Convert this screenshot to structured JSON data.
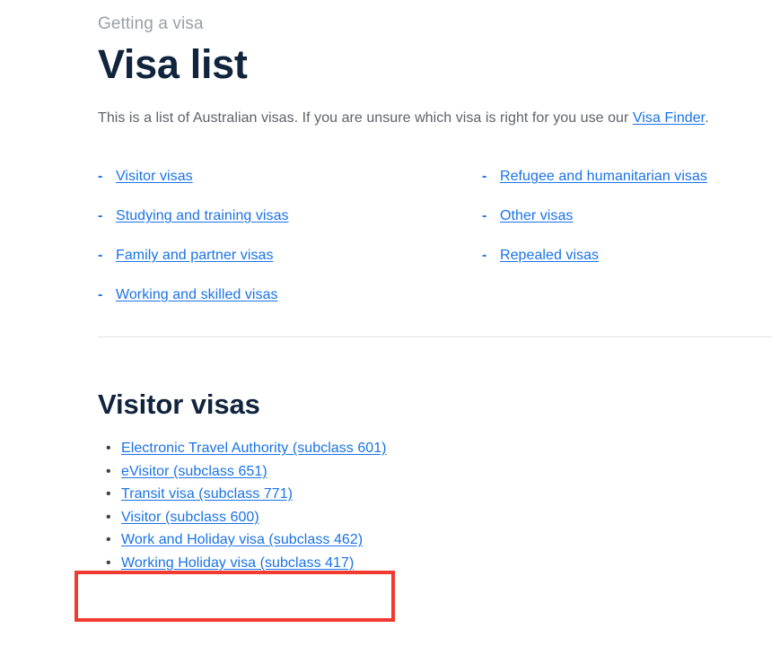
{
  "header": {
    "eyebrow": "Getting a visa",
    "title": "Visa list",
    "intro_before": "This is a list of Australian visas. If you are unsure which visa is right for you use our ",
    "intro_link": "Visa Finder",
    "intro_after": "."
  },
  "category_list": {
    "bullet_glyph": "-",
    "left": [
      {
        "label": "Visitor visas"
      },
      {
        "label": "Studying and training visas"
      },
      {
        "label": "Family and partner visas"
      },
      {
        "label": "Working and skilled visas"
      }
    ],
    "right": [
      {
        "label": "Refugee and humanitarian visas"
      },
      {
        "label": "Other visas"
      },
      {
        "label": "Repealed visas"
      }
    ]
  },
  "section": {
    "title": "Visitor visas",
    "bullet_glyph": "•",
    "items": [
      {
        "label": "Electronic Travel Authority (subclass 601)"
      },
      {
        "label": "eVisitor (subclass 651)"
      },
      {
        "label": "Transit visa (subclass 771) "
      },
      {
        "label": "Visitor (subclass 600)"
      },
      {
        "label": "Work and Holiday visa (subclass 462)"
      },
      {
        "label": "Working Holiday visa (subclass 417)"
      }
    ]
  },
  "annotation": {
    "highlight_color": "#f03b31"
  }
}
